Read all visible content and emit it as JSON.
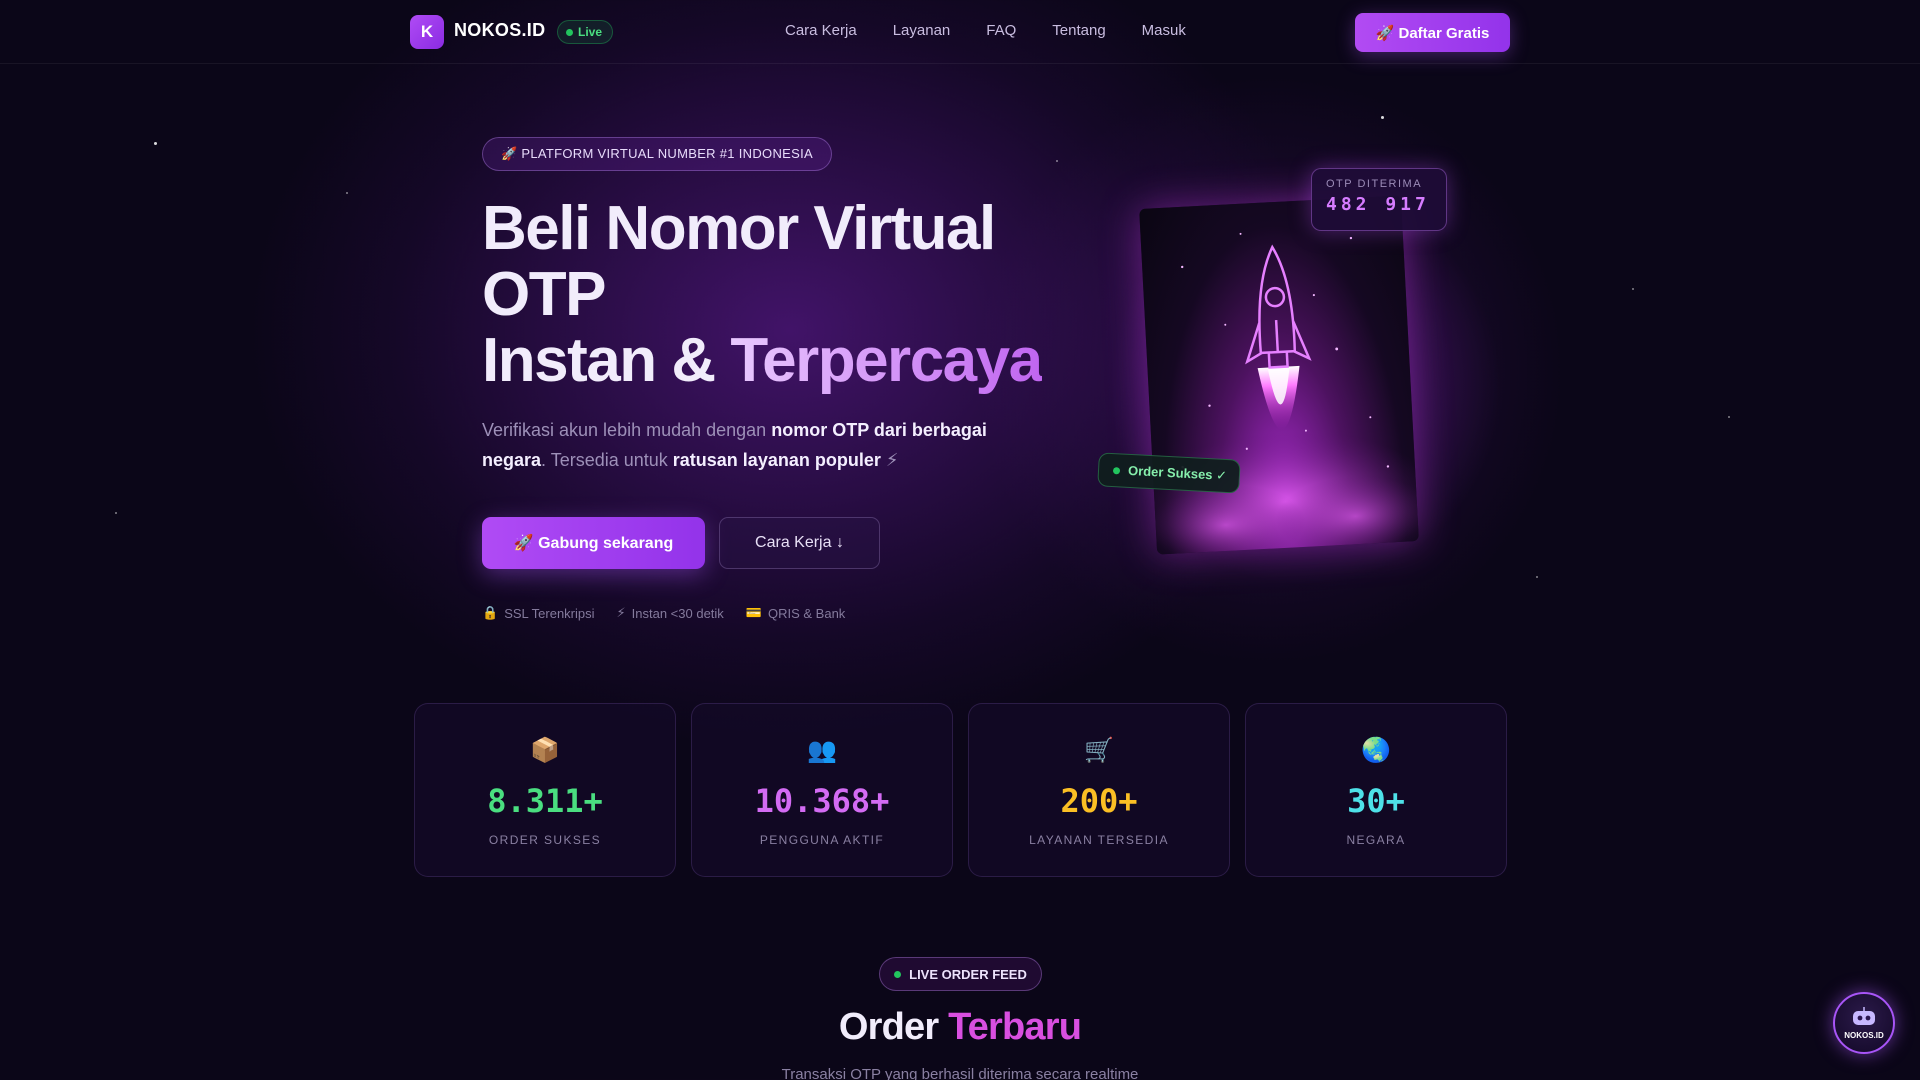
{
  "colors": {
    "background": "#0b0618",
    "accent": "#a855f7",
    "success": "#22c55e",
    "stat_green": "#4ade80",
    "stat_purple": "#d36bf3",
    "stat_yellow": "#fbbf24",
    "stat_cyan": "#4ee1e8"
  },
  "nav": {
    "logo_letter": "K",
    "brand": "NOKOS.ID",
    "live": "Live",
    "links": [
      "Cara Kerja",
      "Layanan",
      "FAQ",
      "Tentang",
      "Masuk"
    ],
    "cta": "🚀 Daftar Gratis"
  },
  "hero": {
    "badge": "🚀 PLATFORM VIRTUAL NUMBER #1 INDONESIA",
    "title_line1": "Beli Nomor Virtual",
    "title_line2": "OTP",
    "title_line3_a": "Instan",
    "title_line3_amp": " & ",
    "title_line3_b": "Terpercaya",
    "sub_part1": "Verifikasi akun lebih mudah dengan ",
    "sub_bold1": "nomor OTP dari berbagai negara",
    "sub_part2": ". Tersedia untuk ",
    "sub_bold2": "ratusan layanan populer",
    "sub_emoji": " ⚡",
    "primary_button": "🚀 Gabung sekarang",
    "secondary_button": "Cara Kerja ↓",
    "trust": [
      {
        "icon": "🔒",
        "label": "SSL Terenkripsi"
      },
      {
        "icon": "⚡",
        "label": "Instan <30 detik"
      },
      {
        "icon": "💳",
        "label": "QRIS & Bank"
      }
    ],
    "otp_label": "OTP DITERIMA",
    "otp_code": "482 917",
    "order_status": "Order Sukses ✓"
  },
  "stats": [
    {
      "icon": "📦",
      "value": "8.311+",
      "label": "ORDER SUKSES"
    },
    {
      "icon": "👥",
      "value": "10.368+",
      "label": "PENGGUNA AKTIF"
    },
    {
      "icon": "🛒",
      "value": "200+",
      "label": "LAYANAN TERSEDIA"
    },
    {
      "icon": "🌏",
      "value": "30+",
      "label": "NEGARA"
    }
  ],
  "feed": {
    "pill": "LIVE ORDER FEED",
    "title_a": "Order ",
    "title_b": "Terbaru",
    "subtitle": "Transaksi OTP yang berhasil diterima secara realtime"
  },
  "chat_fab": {
    "label": "NOKOS.ID",
    "icon": "robot-icon"
  }
}
